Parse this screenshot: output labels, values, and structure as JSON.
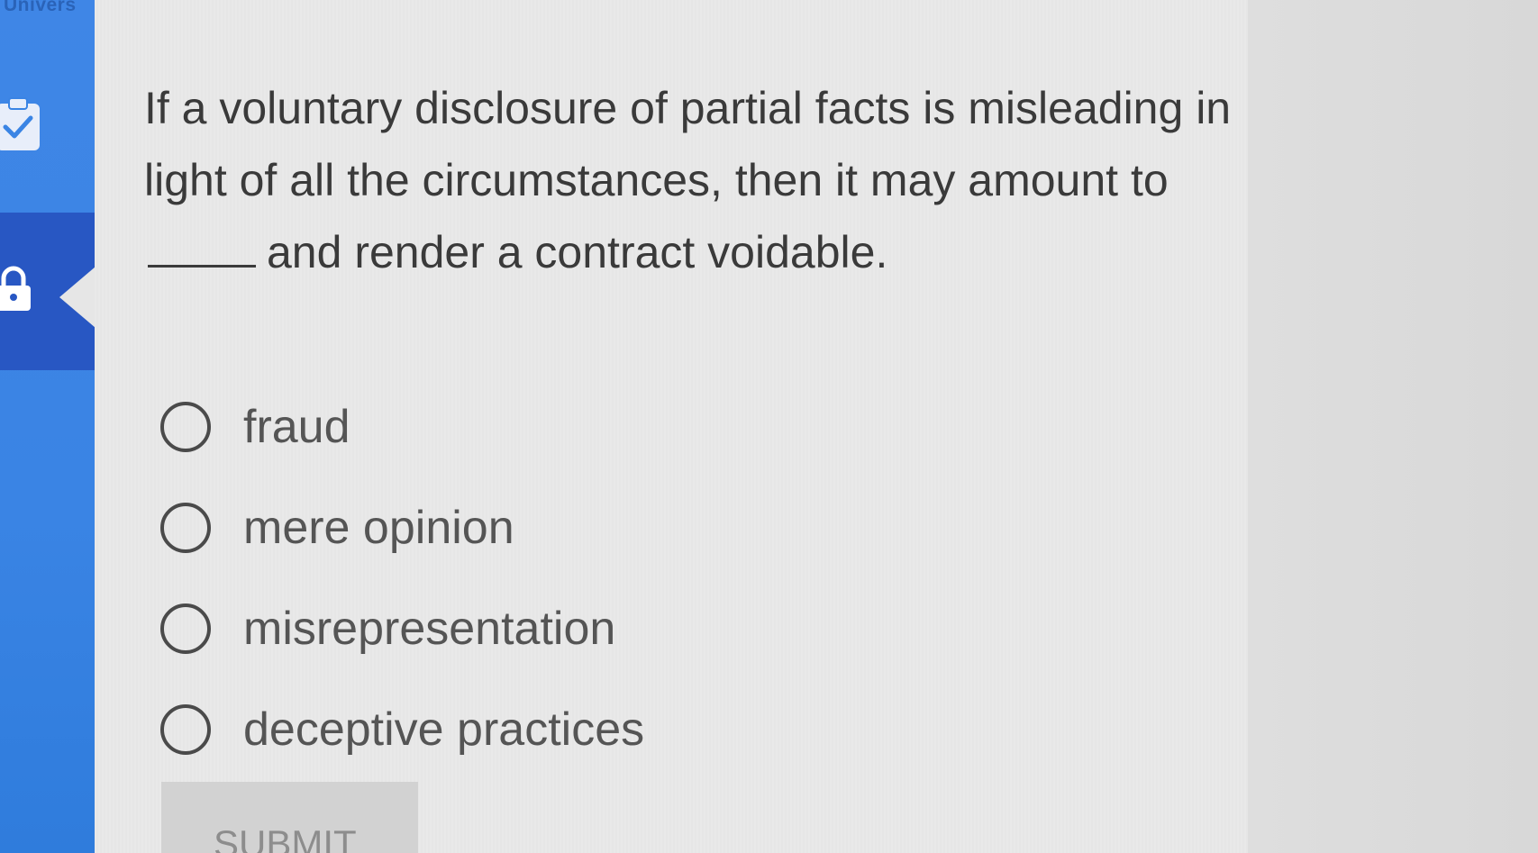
{
  "sidebar": {
    "brand": "Univers",
    "items": [
      {
        "name": "tasks",
        "icon": "clipboard-check-icon"
      },
      {
        "name": "locked",
        "icon": "lock-icon"
      }
    ]
  },
  "question": {
    "part1": "If a voluntary disclosure of partial facts is misleading in light of all the circumstances, then it may amount to",
    "part2": "and render a contract voidable."
  },
  "options": [
    {
      "label": "fraud",
      "selected": false
    },
    {
      "label": "mere opinion",
      "selected": false
    },
    {
      "label": "misrepresentation",
      "selected": false
    },
    {
      "label": "deceptive practices",
      "selected": false
    }
  ],
  "submit": {
    "label": "SUBMIT",
    "disabled": true
  },
  "colors": {
    "sidebar": "#3a84e4",
    "sidebar_active": "#2857c3",
    "text": "#3a3a3a",
    "option_text": "#555555",
    "submit_bg": "#d2d2d2"
  }
}
